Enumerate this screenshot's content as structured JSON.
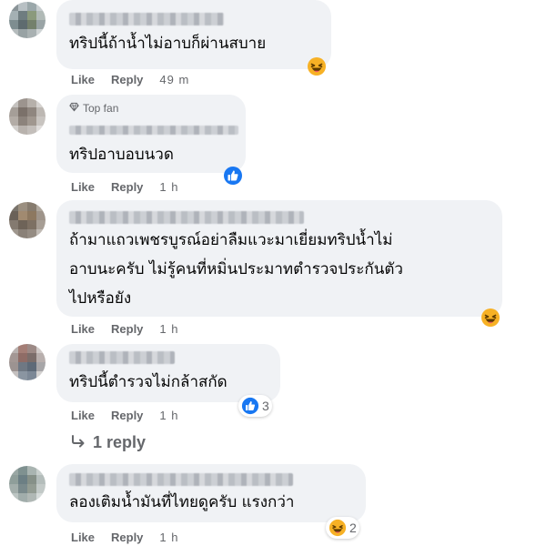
{
  "comments": [
    {
      "top_fan": "",
      "text": "ทริปนี้ถ้าน้ำไม่อาบก็ผ่านสบาย",
      "actions": {
        "like": "Like",
        "reply": "Reply"
      },
      "time": "49 m",
      "reaction": {
        "icon": "haha-icon",
        "count": ""
      }
    },
    {
      "top_fan": "Top fan",
      "text": "ทริปอาบอบนวด",
      "actions": {
        "like": "Like",
        "reply": "Reply"
      },
      "time": "1 h",
      "reaction": {
        "icon": "like-icon",
        "count": ""
      }
    },
    {
      "top_fan": "",
      "text": "ถ้ามาแถวเพชรบูรณ์อย่าลืมแวะมาเยี่ยมทริปน้ำไม่\nอาบนะครับ ไม่รู้คนที่หมิ่นประมาทตำรวจประกันตัว\nไปหรือยัง",
      "actions": {
        "like": "Like",
        "reply": "Reply"
      },
      "time": "1 h",
      "reaction": {
        "icon": "haha-icon",
        "count": ""
      }
    },
    {
      "top_fan": "",
      "text": "ทริปนี้ตำรวจไม่กล้าสกัด",
      "actions": {
        "like": "Like",
        "reply": "Reply"
      },
      "time": "1 h",
      "reaction": {
        "icon": "like-icon",
        "count": "3"
      },
      "replies_label": "1 reply"
    },
    {
      "top_fan": "",
      "text": "ลองเติมน้ำมันที่ไทยดูครับ แรงกว่า",
      "actions": {
        "like": "Like",
        "reply": "Reply"
      },
      "time": "1 h",
      "reaction": {
        "icon": "haha-icon",
        "count": "2"
      }
    }
  ],
  "colors": {
    "bubble": "#f0f2f5",
    "meta_text": "#65676b",
    "like_blue": "#1877f2",
    "haha_yellow": "#f7b125"
  }
}
